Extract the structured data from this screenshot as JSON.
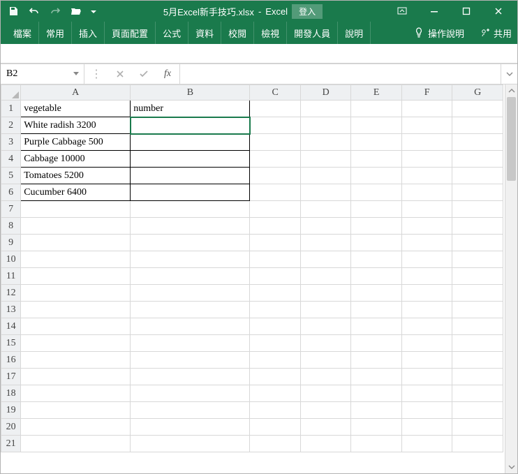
{
  "titlebar": {
    "filename": "5月Excel新手技巧.xlsx",
    "app": "Excel",
    "login": "登入"
  },
  "ribbon": {
    "tabs": [
      "檔案",
      "常用",
      "插入",
      "頁面配置",
      "公式",
      "資料",
      "校閱",
      "檢視",
      "開發人員",
      "說明"
    ],
    "tell_me": "操作說明",
    "share": "共用"
  },
  "namebox": {
    "value": "B2"
  },
  "formula": {
    "value": ""
  },
  "sheet": {
    "columns": [
      "A",
      "B",
      "C",
      "D",
      "E",
      "F",
      "G"
    ],
    "row_count": 21,
    "active_cell": "B2",
    "data": {
      "A1": "vegetable",
      "B1": "number",
      "A2": "White radish 3200",
      "A3": "Purple Cabbage 500",
      "A4": "Cabbage 10000",
      "A5": "Tomatoes 5200",
      "A6": "Cucumber 6400"
    }
  }
}
